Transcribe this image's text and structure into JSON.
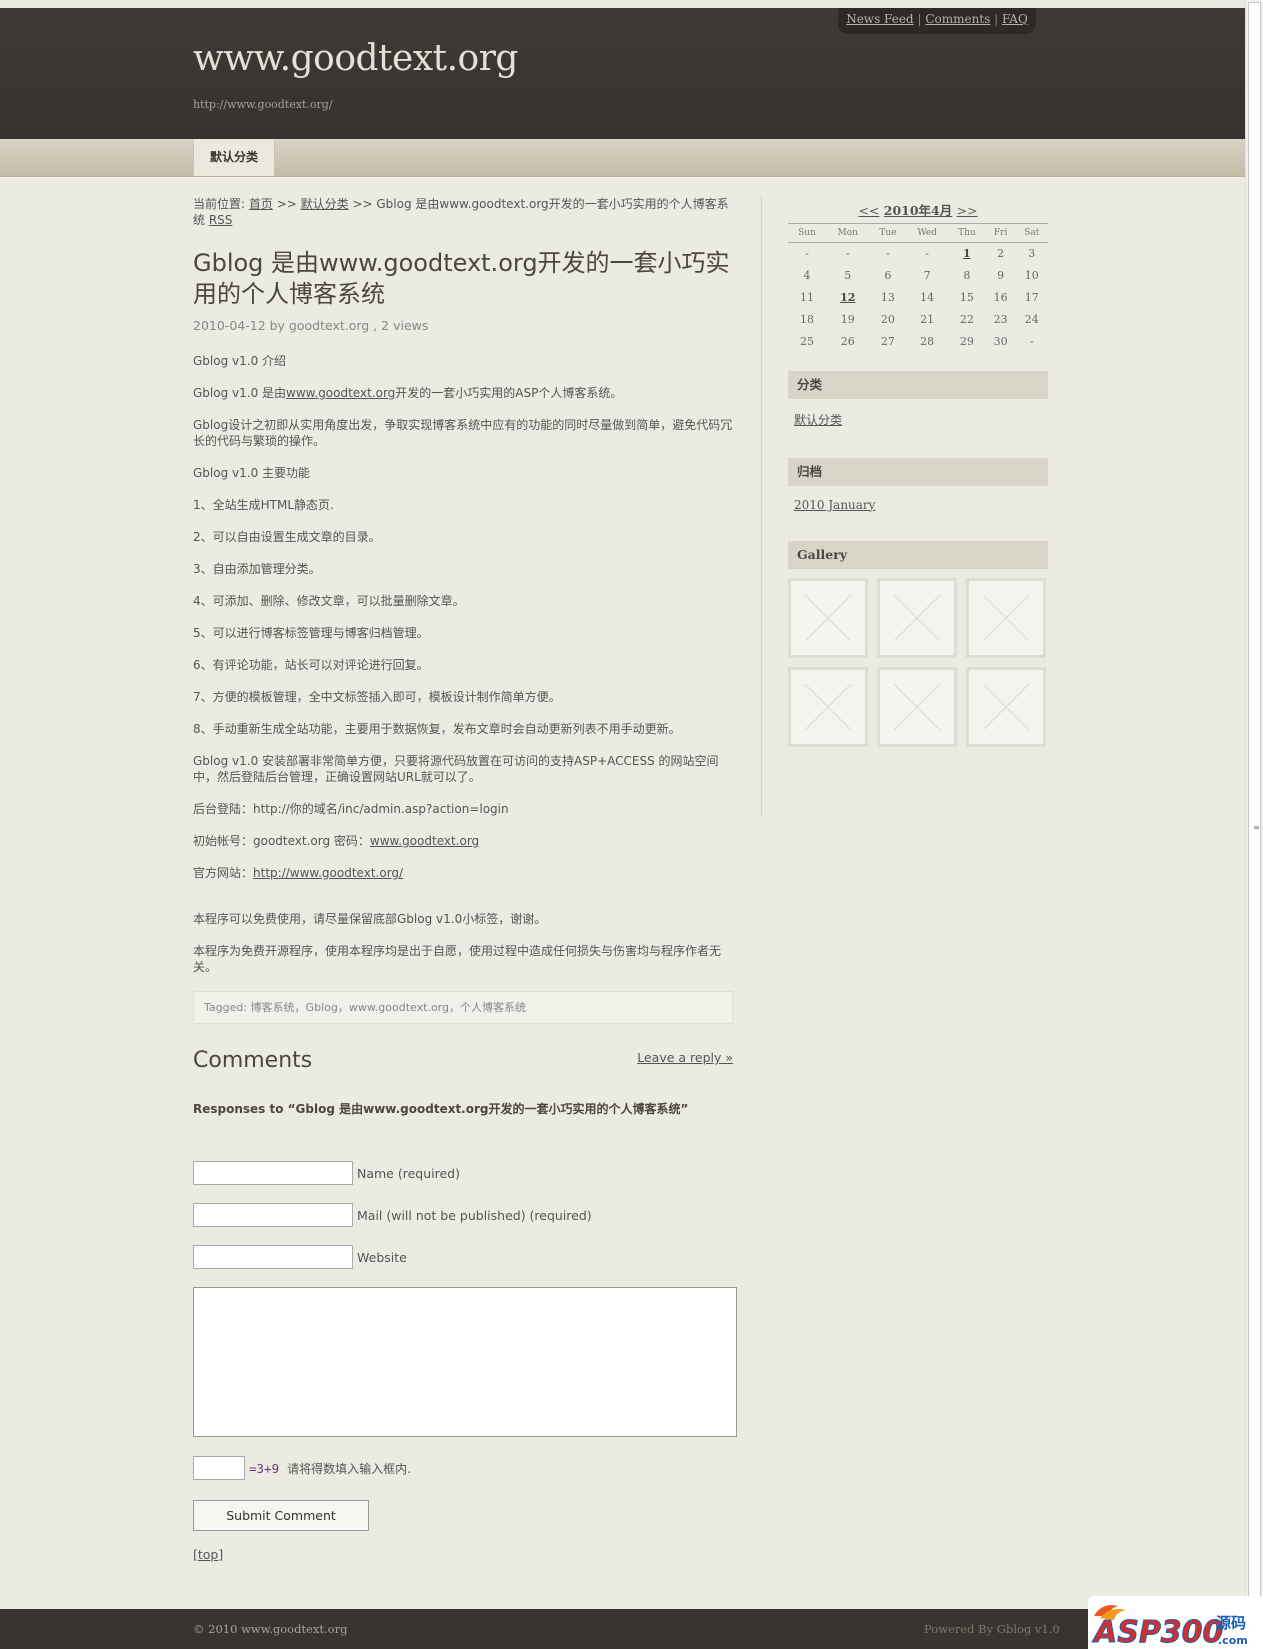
{
  "header": {
    "site_title": "www.goodtext.org",
    "site_url": "http://www.goodtext.org/",
    "top_links": [
      "News Feed",
      "Comments",
      "FAQ"
    ]
  },
  "nav": {
    "category_tab": "默认分类"
  },
  "breadcrumb": {
    "prefix": "当前位置: ",
    "home": "首页",
    "sep1": " >> ",
    "category": "默认分类",
    "sep2": " >> Gblog 是由www.goodtext.org开发的一套小巧实用的个人博客系统 ",
    "rss": "RSS"
  },
  "post": {
    "title": "Gblog 是由www.goodtext.org开发的一套小巧实用的个人博客系统",
    "meta": "2010-04-12 by goodtext.org , 2 views",
    "intro_heading": "Gblog v1.0 介绍",
    "intro_pre": "Gblog v1.0 是由",
    "intro_link": "www.goodtext.org",
    "intro_post": "开发的一套小巧实用的ASP个人博客系统。",
    "design": "Gblog设计之初即从实用角度出发，争取实现博客系统中应有的功能的同时尽量做到简单，避免代码冗长的代码与繁琐的操作。",
    "features_heading": "Gblog v1.0 主要功能",
    "features": [
      "1、全站生成HTML静态页.",
      "2、可以自由设置生成文章的目录。",
      "3、自由添加管理分类。",
      "4、可添加、删除、修改文章，可以批量删除文章。",
      "5、可以进行博客标签管理与博客归档管理。",
      "6、有评论功能，站长可以对评论进行回复。",
      "7、方便的模板管理，全中文标签插入即可，模板设计制作简单方便。",
      "8、手动重新生成全站功能，主要用于数据恢复，发布文章时会自动更新列表不用手动更新。"
    ],
    "install": "Gblog v1.0 安装部署非常简单方便，只要将源代码放置在可访问的支持ASP+ACCESS 的网站空间中，然后登陆后台管理，正确设置网站URL就可以了。",
    "admin_login": "后台登陆：http://你的域名/inc/admin.asp?action=login",
    "account_pre": "初始帐号：goodtext.org  密码：",
    "account_link": "www.goodtext.org",
    "official_pre": "官方网站：",
    "official_link": "http://www.goodtext.org/",
    "free": "本程序可以免费使用，请尽量保留底部Gblog v1.0小标签，谢谢。",
    "disclaimer": "本程序为免费开源程序，使用本程序均是出于自愿，使用过程中造成任何损失与伤害均与程序作者无关。",
    "tags": "Tagged: 博客系统，Gblog，www.goodtext.org，个人博客系统"
  },
  "comments": {
    "title": "Comments",
    "leave_reply": "Leave a reply »",
    "responses": "Responses to “Gblog 是由www.goodtext.org开发的一套小巧实用的个人博客系统”",
    "name_label": "Name (required)",
    "mail_label": "Mail (will not be published) (required)",
    "website_label": "Website",
    "captcha_question": "=3+9",
    "captcha_hint": "请将得数填入输入框内.",
    "submit": "Submit Comment",
    "top": "[top]"
  },
  "sidebar": {
    "calendar": {
      "prev": "<<",
      "month": "2010年4月",
      "next": ">>",
      "days": [
        "Sun",
        "Mon",
        "Tue",
        "Wed",
        "Thu",
        "Fri",
        "Sat"
      ],
      "weeks": [
        [
          "-",
          "-",
          "-",
          "-",
          "1",
          "2",
          "3"
        ],
        [
          "4",
          "5",
          "6",
          "7",
          "8",
          "9",
          "10"
        ],
        [
          "11",
          "12",
          "13",
          "14",
          "15",
          "16",
          "17"
        ],
        [
          "18",
          "19",
          "20",
          "21",
          "22",
          "23",
          "24"
        ],
        [
          "25",
          "26",
          "27",
          "28",
          "29",
          "30",
          "-"
        ]
      ],
      "linked_days": [
        "1",
        "12"
      ]
    },
    "categories_title": "分类",
    "categories_link": "默认分类",
    "archive_title": "归档",
    "archive_link": "2010 January",
    "gallery_title": "Gallery"
  },
  "footer": {
    "copyright": "© 2010 www.goodtext.org",
    "powered": "Powered By Gblog v1.0"
  },
  "watermark": {
    "text": "ASP300",
    "suffix": "源码",
    "suffix2": ".com"
  }
}
